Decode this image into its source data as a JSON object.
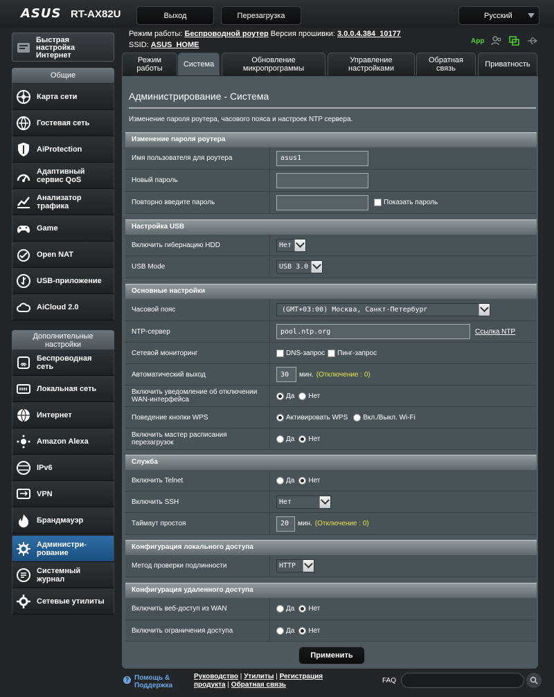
{
  "header": {
    "logo": "ASUS",
    "model": "RT-AX82U",
    "logout_label": "Выход",
    "reboot_label": "Перезагрузка",
    "language": "Русский"
  },
  "info": {
    "mode_label": "Режим работы:",
    "mode_value": "Беспроводной роутер",
    "firmware_label": "Версия прошивки:",
    "firmware_value": "3.0.0.4.384_10177",
    "ssid_label": "SSID:",
    "ssid_value": "ASUS_HOME",
    "app_label": "App"
  },
  "sidebar": {
    "quick_setup_lines": [
      "Быстрая",
      "настройка",
      "Интернет"
    ],
    "general_header": "Общие",
    "general_items": [
      {
        "label": "Карта сети",
        "icon": "network-map-icon"
      },
      {
        "label": "Гостевая сеть",
        "icon": "guest-network-icon"
      },
      {
        "label": "AiProtection",
        "icon": "shield-icon"
      },
      {
        "label": "Адаптивный сервис QoS",
        "icon": "qos-icon"
      },
      {
        "label": "Анализатор трафика",
        "icon": "traffic-analyzer-icon"
      },
      {
        "label": "Game",
        "icon": "gamepad-icon"
      },
      {
        "label": "Open NAT",
        "icon": "open-nat-icon"
      },
      {
        "label": "USB-приложение",
        "icon": "usb-icon"
      },
      {
        "label": "AiCloud 2.0",
        "icon": "cloud-icon"
      }
    ],
    "advanced_header": "Дополнительные настройки",
    "advanced_items": [
      {
        "label": "Беспроводная сеть",
        "icon": "wireless-icon"
      },
      {
        "label": "Локальная сеть",
        "icon": "lan-icon"
      },
      {
        "label": "Интернет",
        "icon": "globe-icon"
      },
      {
        "label": "Amazon Alexa",
        "icon": "alexa-icon"
      },
      {
        "label": "IPv6",
        "icon": "ipv6-icon"
      },
      {
        "label": "VPN",
        "icon": "vpn-icon"
      },
      {
        "label": "Брандмауэр",
        "icon": "firewall-icon"
      },
      {
        "label": "Администри-рование",
        "icon": "admin-gear-icon",
        "active": true
      },
      {
        "label": "Системный журнал",
        "icon": "syslog-icon"
      },
      {
        "label": "Сетевые утилиты",
        "icon": "tools-icon"
      }
    ]
  },
  "tabs": [
    {
      "label": "Режим работы"
    },
    {
      "label": "Система",
      "active": true
    },
    {
      "label": "Обновление микропрограммы"
    },
    {
      "label": "Управление настройками"
    },
    {
      "label": "Обратная связь"
    },
    {
      "label": "Приватность"
    }
  ],
  "page": {
    "title": "Администрирование - Система",
    "description": "Изменение пароля роутера, часового пояса и настроек NTP сервера."
  },
  "sections": {
    "password": {
      "header": "Изменение пароля роутера",
      "username_label": "Имя пользователя для роутера",
      "username_value": "asus1",
      "new_password_label": "Новый пароль",
      "repeat_password_label": "Повторно введите пароль",
      "show_password_label": "Показать пароль"
    },
    "usb": {
      "header": "Настройка USB",
      "hdd_label": "Включить гибернацию HDD",
      "hdd_value": "Нет",
      "usb_mode_label": "USB Mode",
      "usb_mode_value": "USB 3.0"
    },
    "basic": {
      "header": "Основные настройки",
      "timezone_label": "Часовой пояс",
      "timezone_value": "(GMT+03:00) Москва, Санкт-Петербург",
      "ntp_label": "NTP-сервер",
      "ntp_value": "pool.ntp.org",
      "ntp_link": "Ссылка NTP",
      "monitoring_label": "Сетевой мониторинг",
      "dns_query": "DNS-запрос",
      "ping_query": "Пинг-запрос",
      "autologout_label": "Автоматический выход",
      "autologout_value": "30",
      "minutes": "мин.",
      "autologout_note": "(Отключение : 0)",
      "wan_notify_label": "Включить уведомление об отключении WAN-интерфейса",
      "yes": "Да",
      "no": "Нет",
      "wps_label": "Поведение кнопки WPS",
      "wps_opt1": "Активировать WPS",
      "wps_opt2": "Вкл./Выкл. Wi-Fi",
      "reboot_sched_label": "Включить мастер расписания перезагрузок"
    },
    "service": {
      "header": "Служба",
      "telnet_label": "Включить Telnet",
      "ssh_label": "Включить SSH",
      "ssh_value": "Нет",
      "idle_label": "Таймаут простоя",
      "idle_value": "20",
      "idle_note": "(Отключение : 0)"
    },
    "local_access": {
      "header": "Конфигурация локального доступа",
      "auth_label": "Метод проверки подлинности",
      "auth_value": "HTTP"
    },
    "remote_access": {
      "header": "Конфигурация удаленного доступа",
      "wan_web_label": "Включить веб-доступ из WAN",
      "restrict_label": "Включить ограничения доступа"
    }
  },
  "apply_label": "Применить",
  "footer": {
    "help_line1": "Помощь &",
    "help_line2": "Поддержка",
    "link_manual": "Руководство",
    "link_utils": "Утилиты",
    "link_register_line1": "Регистрация",
    "link_register_line2": "продукта",
    "link_feedback": "Обратная связь",
    "sep": "|",
    "faq": "FAQ"
  },
  "colors": {
    "panel": "#4d595e",
    "active_menu": "#2e6ea6",
    "note_yellow": "#e8e24f",
    "app_green": "#4fd12a"
  }
}
